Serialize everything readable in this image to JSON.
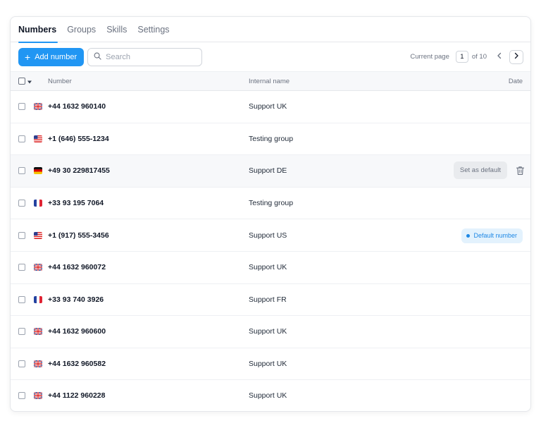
{
  "tabs": [
    {
      "label": "Numbers",
      "active": true
    },
    {
      "label": "Groups",
      "active": false
    },
    {
      "label": "Skills",
      "active": false
    },
    {
      "label": "Settings",
      "active": false
    }
  ],
  "toolbar": {
    "add_button_label": "Add number",
    "search_placeholder": "Search",
    "current_page_label": "Current page",
    "current_page": "1",
    "of_label": "of 10"
  },
  "table": {
    "columns": {
      "number": "Number",
      "internal_name": "Internal name",
      "date": "Date"
    },
    "rows": [
      {
        "flag": "uk",
        "number": "+44 1632 960140",
        "internal_name": "Support UK"
      },
      {
        "flag": "us",
        "number": "+1 (646) 555-1234",
        "internal_name": "Testing group"
      },
      {
        "flag": "de",
        "number": "+49 30 229817455",
        "internal_name": "Support DE",
        "action": "Set as default"
      },
      {
        "flag": "fr",
        "number": "+33 93 195 7064",
        "internal_name": "Testing group"
      },
      {
        "flag": "us",
        "number": "+1 (917) 555-3456",
        "internal_name": "Support US",
        "badge": "Default number"
      },
      {
        "flag": "uk",
        "number": "+44 1632 960072",
        "internal_name": "Support UK"
      },
      {
        "flag": "fr",
        "number": "+33 93 740 3926",
        "internal_name": "Support FR"
      },
      {
        "flag": "uk",
        "number": "+44 1632 960600",
        "internal_name": "Support UK"
      },
      {
        "flag": "uk",
        "number": "+44 1632 960582",
        "internal_name": "Support UK"
      },
      {
        "flag": "uk",
        "number": "+44 1122 960228",
        "internal_name": "Support UK"
      }
    ]
  },
  "colors": {
    "accent": "#2196f3",
    "badge_bg": "#e3f2fd",
    "badge_text": "#1e88e5"
  },
  "icons": {
    "add": "plus-icon",
    "search": "search-icon",
    "prev": "chevron-left-icon",
    "next": "chevron-right-icon",
    "select_menu": "caret-down-icon",
    "delete": "trash-icon"
  }
}
